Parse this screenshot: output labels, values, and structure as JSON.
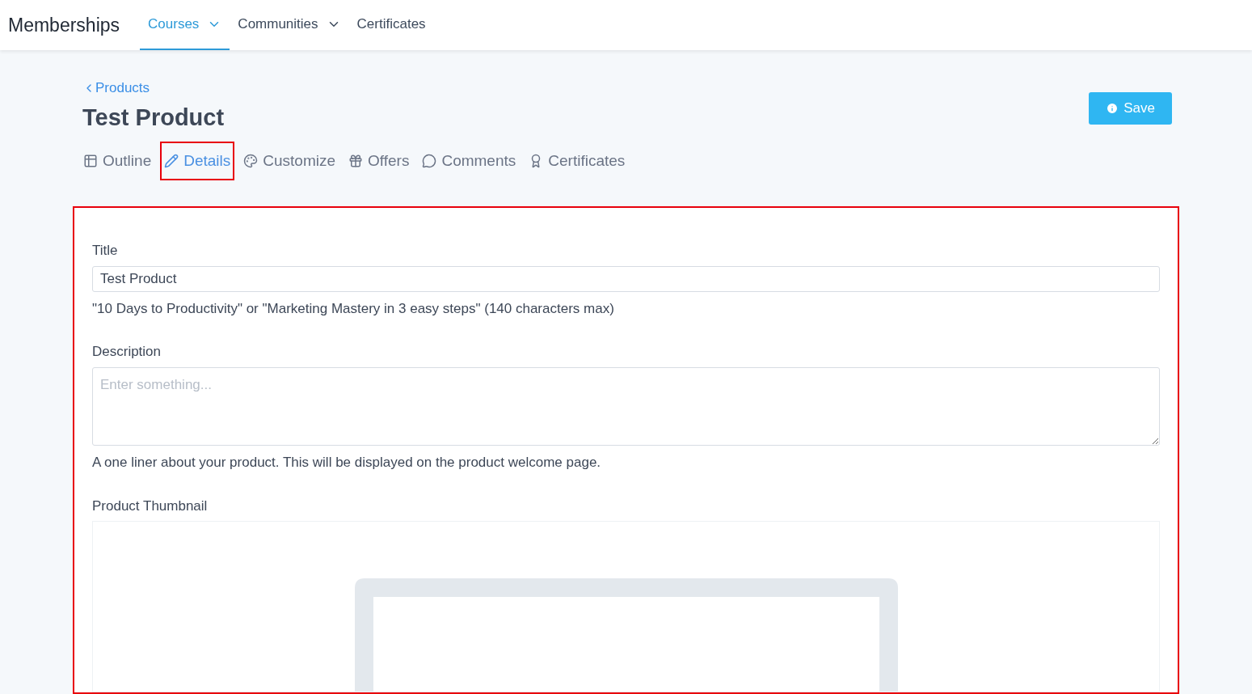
{
  "nav": {
    "brand": "Memberships",
    "items": [
      {
        "label": "Courses",
        "selected": true,
        "dropdown": true
      },
      {
        "label": "Communities",
        "selected": false,
        "dropdown": true
      },
      {
        "label": "Certificates",
        "selected": false,
        "dropdown": false
      }
    ]
  },
  "back_link": "Products",
  "page_title": "Test Product",
  "save_button": "Save",
  "tabs": [
    {
      "label": "Outline",
      "selected": false,
      "highlighted": false
    },
    {
      "label": "Details",
      "selected": true,
      "highlighted": true
    },
    {
      "label": "Customize",
      "selected": false,
      "highlighted": false
    },
    {
      "label": "Offers",
      "selected": false,
      "highlighted": false
    },
    {
      "label": "Comments",
      "selected": false,
      "highlighted": false
    },
    {
      "label": "Certificates",
      "selected": false,
      "highlighted": false
    }
  ],
  "form": {
    "highlighted": true,
    "title_field": {
      "label": "Title",
      "value": "Test Product",
      "help": "\"10 Days to Productivity\" or \"Marketing Mastery in 3 easy steps\" (140 characters max)"
    },
    "description_field": {
      "label": "Description",
      "placeholder": "Enter something...",
      "help": "A one liner about your product. This will be displayed on the product welcome page."
    },
    "thumbnail": {
      "label": "Product Thumbnail"
    }
  }
}
